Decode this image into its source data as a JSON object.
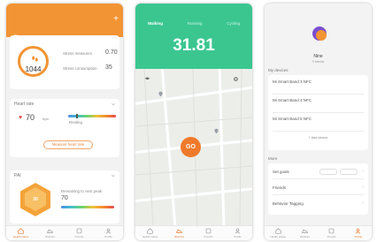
{
  "screen1": {
    "status": {
      "left": "",
      "right": ""
    },
    "header": {
      "add_glyph": "+"
    },
    "stress": {
      "title": "Stress",
      "score": "1044",
      "label1": "Stress measures",
      "value1": "0.70",
      "label2": "Stress consumption",
      "value2": "35"
    },
    "heart_rate": {
      "title": "Heart rate",
      "bpm": "70",
      "bpm_unit": "bpm",
      "zone_label": "Resting",
      "measure_button": "Measure heart rate"
    },
    "pai": {
      "title": "PAI",
      "value": "30",
      "remaining_label": "Remaining to next peak",
      "remaining_value": "70"
    },
    "tabs": [
      "Health status",
      "Workout",
      "Friends",
      "Profile"
    ]
  },
  "screen2": {
    "status": {
      "left": "",
      "right": ""
    },
    "modes": [
      "Walking",
      "Running",
      "Cycling"
    ],
    "distance": "31.81",
    "distance_unit": "",
    "go_button": "GO",
    "tabs": [
      "Health status",
      "Workout",
      "Friends",
      "Profile"
    ]
  },
  "screen3": {
    "status": {
      "left": "",
      "right": ""
    },
    "user": {
      "name": "Nine",
      "sub": "0 friends"
    },
    "devices_title": "My devices",
    "devices": [
      {
        "name": "Mi Smart Band 3 NFC",
        "sub": "",
        "right": ""
      },
      {
        "name": "Mi Smart Band 4 NFC",
        "sub": "",
        "right": ""
      },
      {
        "name": "Mi Smart Band 5 NFC",
        "sub": "",
        "right": ""
      }
    ],
    "add_device": "+ Add device",
    "more_title": "More",
    "more_items": [
      {
        "label": "Set goals",
        "pill1": "",
        "pill2": ""
      },
      {
        "label": "Friends"
      },
      {
        "label": "Behavior Tagging"
      }
    ],
    "tabs": [
      "Health status",
      "Workout",
      "Friends",
      "Profile"
    ]
  },
  "colors": {
    "orange": "#f29434",
    "green": "#3bc690",
    "go": "#ef7a2b"
  }
}
